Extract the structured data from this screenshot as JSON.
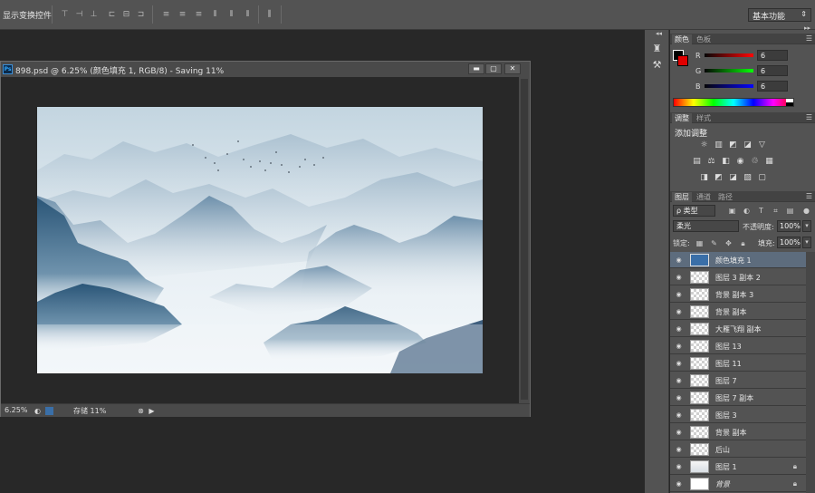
{
  "options_bar": {
    "label": "显示变换控件",
    "workspace": "基本功能"
  },
  "document": {
    "title": "898.psd @ 6.25% (颜色填充 1, RGB/8) - Saving 11%",
    "app_badge": "Ps",
    "zoom": "6.25%",
    "status": "存储 11%",
    "buttons": {
      "minimize": "▬",
      "maximize": "▢",
      "close": "✕"
    }
  },
  "color_panel": {
    "tabs": [
      "颜色",
      "色板"
    ],
    "channels": [
      {
        "label": "R",
        "value": "6",
        "color": "#e02020"
      },
      {
        "label": "G",
        "value": "6",
        "color": "#20b020"
      },
      {
        "label": "B",
        "value": "6",
        "color": "#2040e0"
      }
    ],
    "foreground": "#000000",
    "background": "#e00000"
  },
  "adjust_panel": {
    "tabs": [
      "调整",
      "样式"
    ],
    "title": "添加调整"
  },
  "layers_panel": {
    "tabs": [
      "图层",
      "通道",
      "路径"
    ],
    "kind_filter": "ρ 类型",
    "blend_mode": "柔光",
    "opacity_label": "不透明度:",
    "opacity": "100%",
    "lock_label": "锁定:",
    "fill_label": "填充:",
    "fill": "100%",
    "layers": [
      {
        "name": "颜色填充 1",
        "thumb": "fill",
        "selected": true
      },
      {
        "name": "图层 3 副本 2",
        "thumb": "check"
      },
      {
        "name": "背景 副本 3",
        "thumb": "check"
      },
      {
        "name": "背景 副本",
        "thumb": "check"
      },
      {
        "name": "大雁飞翔 副本",
        "thumb": "check"
      },
      {
        "name": "图层 13",
        "thumb": "check"
      },
      {
        "name": "图层 11",
        "thumb": "check"
      },
      {
        "name": "图层 7",
        "thumb": "check"
      },
      {
        "name": "图层 7 副本",
        "thumb": "check"
      },
      {
        "name": "图层 3",
        "thumb": "check"
      },
      {
        "name": "背景 副本",
        "thumb": "check"
      },
      {
        "name": "后山",
        "thumb": "check"
      },
      {
        "name": "图层 1",
        "thumb": "grad",
        "locked": true
      },
      {
        "name": "背景",
        "thumb": "white",
        "locked": true,
        "italic": true
      }
    ]
  }
}
